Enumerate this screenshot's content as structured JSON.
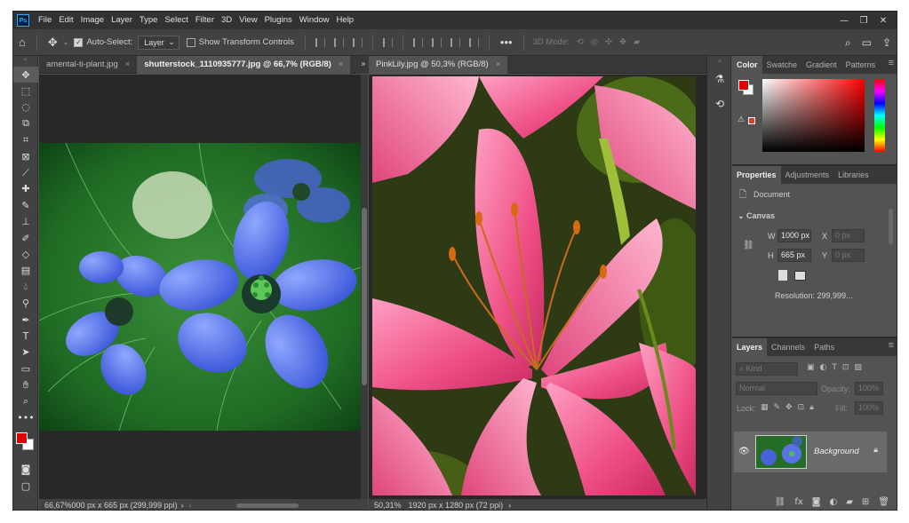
{
  "app": {
    "logo": "Ps"
  },
  "menu": [
    "File",
    "Edit",
    "Image",
    "Layer",
    "Type",
    "Select",
    "Filter",
    "3D",
    "View",
    "Plugins",
    "Window",
    "Help"
  ],
  "window_controls": [
    "—",
    "❐",
    "✕"
  ],
  "options": {
    "auto_select_label": "Auto-Select:",
    "auto_select_value": "Layer",
    "transform_label": "Show Transform Controls",
    "mode3d_label": "3D Mode:"
  },
  "tabs_left": [
    {
      "label": "amental-ti-plant.jpg",
      "close": "×"
    },
    {
      "label": "shutterstock_1110935777.jpg @ 66,7% (RGB/8)",
      "close": "×"
    }
  ],
  "tabs_right": [
    {
      "label": "PinkLily.jpg @ 50,3% (RGB/8)",
      "close": "×"
    }
  ],
  "tab_overflow": "»",
  "status_left": {
    "zoom": "66,67%",
    "info": "000 px x 665 px (299,999 ppi)",
    "arrow": "›"
  },
  "status_right": {
    "zoom": "50,31%",
    "info": "1920 px x 1280 px (72 ppi)",
    "arrow": "›"
  },
  "color_panel": {
    "tabs": [
      "Color",
      "Swatche",
      "Gradient",
      "Patterns"
    ],
    "menu": "≡"
  },
  "properties_panel": {
    "tabs": [
      "Properties",
      "Adjustments",
      "Libraries"
    ],
    "doc_label": "Document",
    "section": "Canvas",
    "w_label": "W",
    "w_value": "1000 px",
    "h_label": "H",
    "h_value": "665 px",
    "x_label": "X",
    "x_value": "0 px",
    "y_label": "Y",
    "y_value": "0 px",
    "resolution": "Resolution: 299,999..."
  },
  "layers_panel": {
    "tabs": [
      "Layers",
      "Channels",
      "Paths"
    ],
    "menu": "≡",
    "kind_placeholder": "Kind",
    "blend_mode": "Normal",
    "opacity_label": "Opacity:",
    "opacity_value": "100%",
    "lock_label": "Lock:",
    "fill_label": "Fill:",
    "fill_value": "100%",
    "layer_name": "Background"
  },
  "colors": {
    "foreground": "#e00000",
    "background": "#ffffff",
    "ui_dark": "#323232",
    "ui_mid": "#424242",
    "ui_panel": "#535353"
  }
}
